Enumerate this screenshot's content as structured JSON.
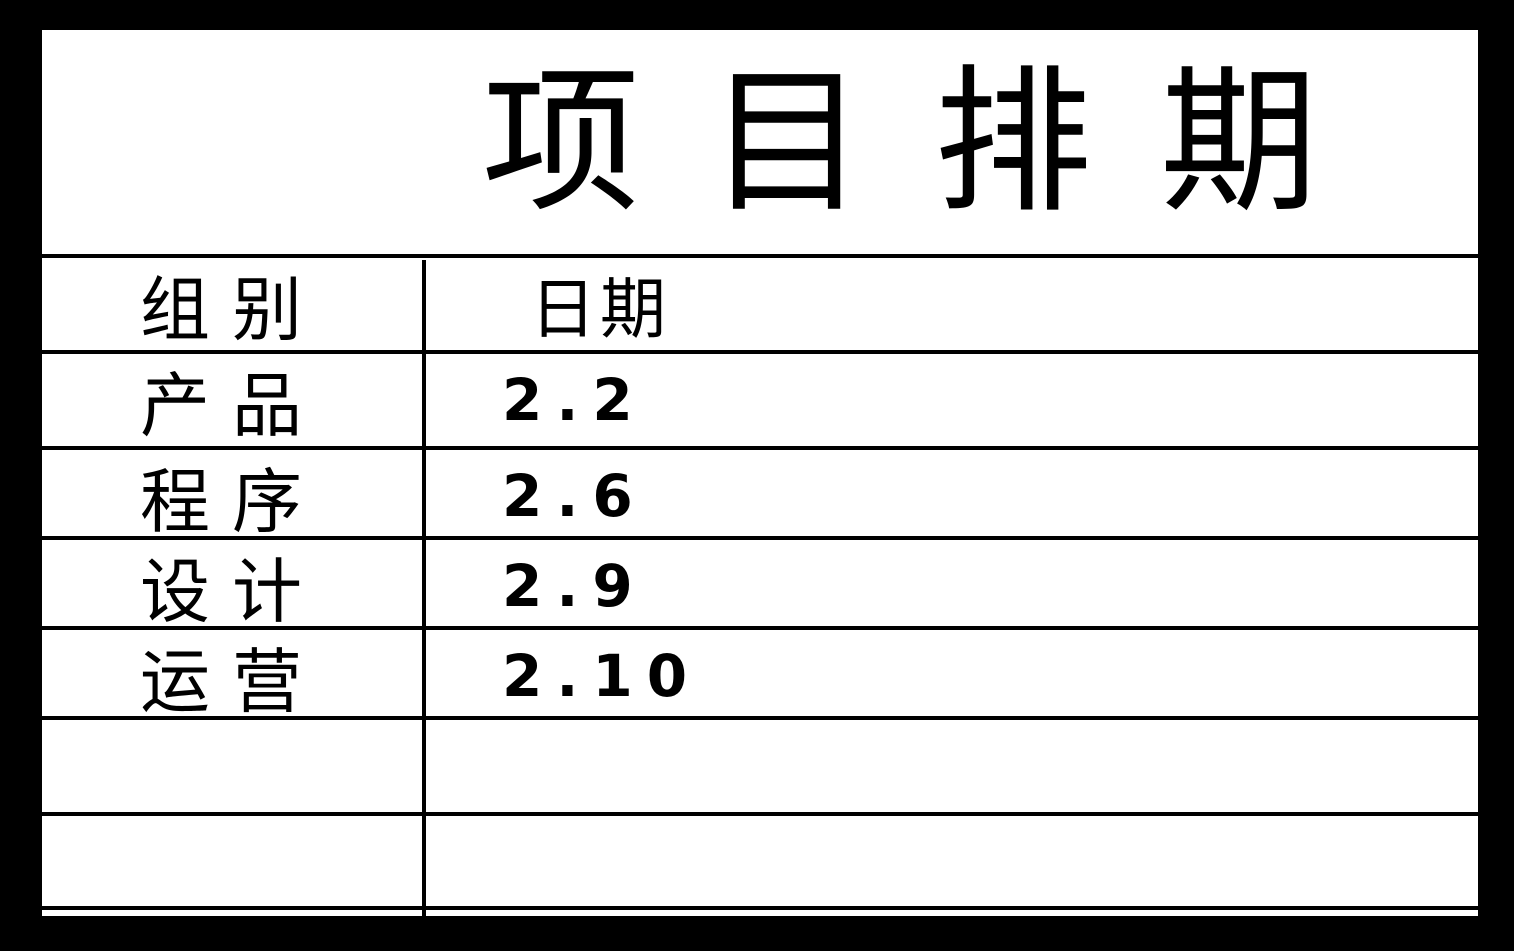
{
  "title": "项目排期",
  "table": {
    "headers": {
      "group": "组别",
      "date": "日期"
    },
    "rows": [
      {
        "group": "产品",
        "date": "2.2"
      },
      {
        "group": "程序",
        "date": "2.6"
      },
      {
        "group": "设计",
        "date": "2.9"
      },
      {
        "group": "运营",
        "date": "2.10"
      },
      {
        "group": "",
        "date": ""
      },
      {
        "group": "",
        "date": ""
      }
    ]
  },
  "colors": {
    "frame": "#000000",
    "board": "#ffffff",
    "ink": "#000000"
  }
}
